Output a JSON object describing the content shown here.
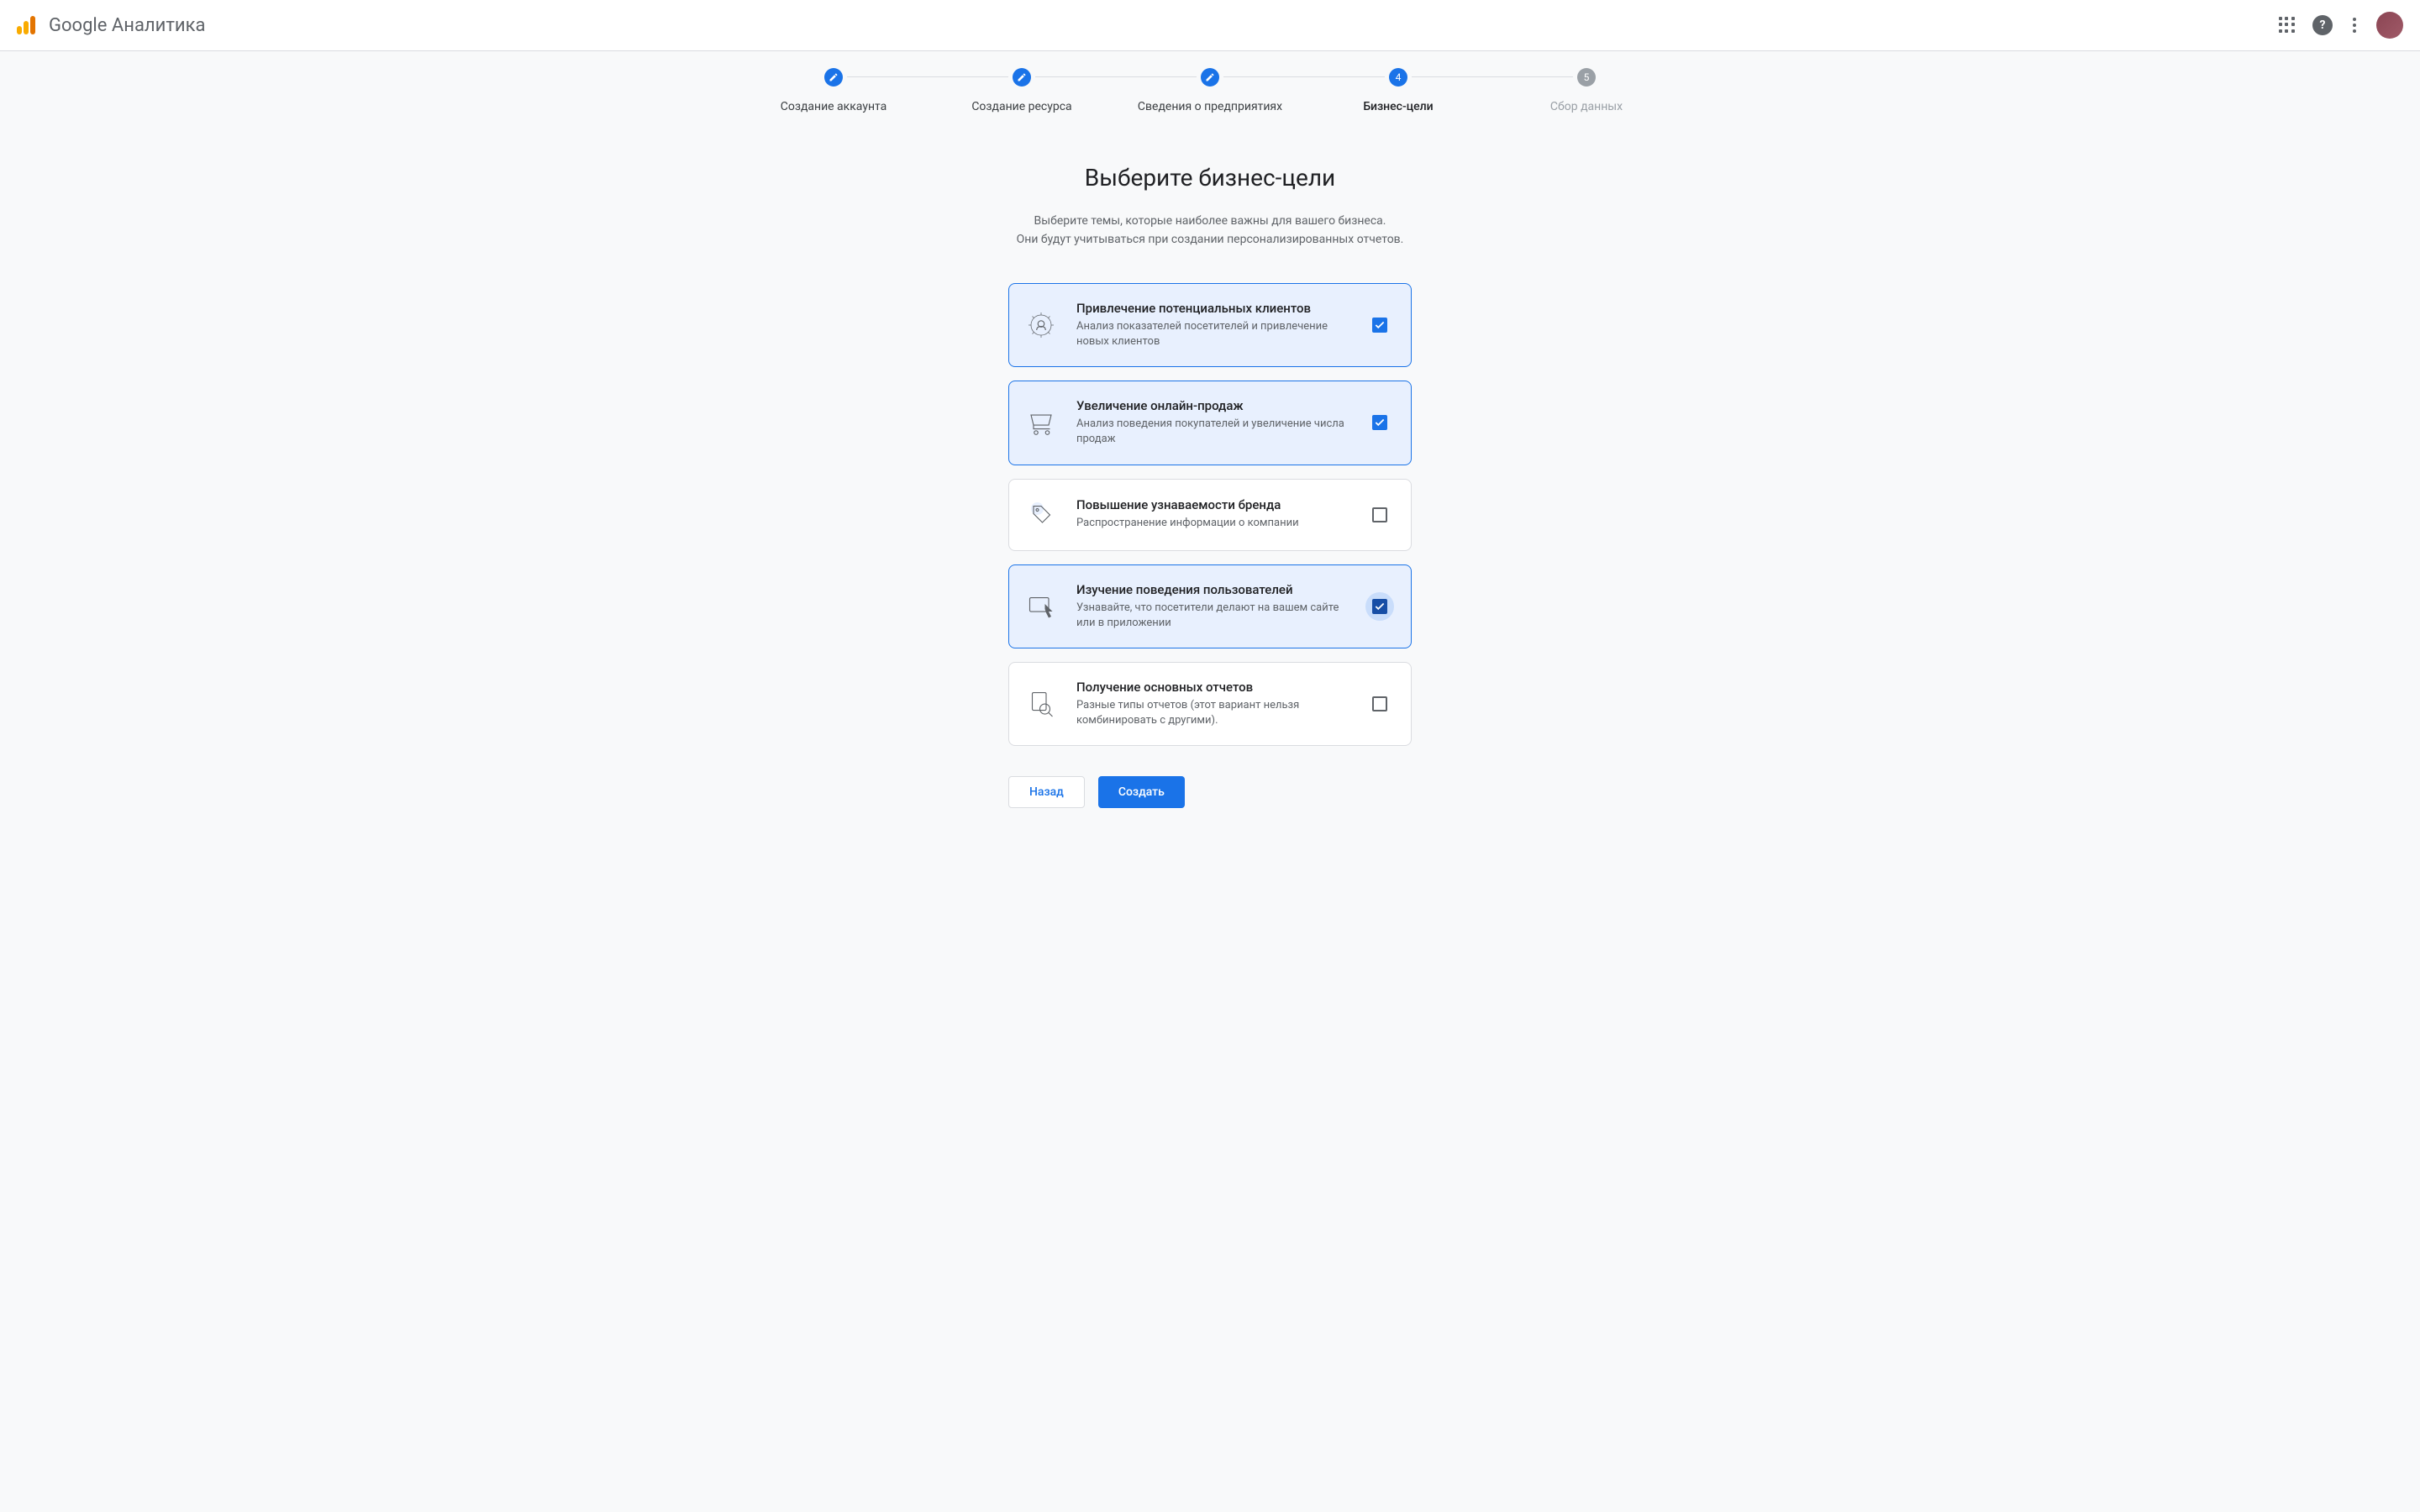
{
  "header": {
    "product_name": "Google Аналитика"
  },
  "stepper": {
    "steps": [
      {
        "label": "Создание аккаунта",
        "state": "completed"
      },
      {
        "label": "Создание ресурса",
        "state": "completed"
      },
      {
        "label": "Сведения о предприятиях",
        "state": "completed"
      },
      {
        "label": "Бизнес-цели",
        "state": "current",
        "number": "4"
      },
      {
        "label": "Сбор данных",
        "state": "pending",
        "number": "5"
      }
    ]
  },
  "content": {
    "title": "Выберите бизнес-цели",
    "subtitle_line1": "Выберите темы, которые наиболее важны для вашего бизнеса.",
    "subtitle_line2": "Они будут учитываться при создании персонализированных отчетов."
  },
  "cards": [
    {
      "title": "Привлечение потенциальных клиентов",
      "desc": "Анализ показателей посетителей и привлечение новых клиентов",
      "checked": true,
      "icon": "leads"
    },
    {
      "title": "Увеличение онлайн-продаж",
      "desc": "Анализ поведения покупателей и увеличение числа продаж",
      "checked": true,
      "icon": "cart"
    },
    {
      "title": "Повышение узнаваемости бренда",
      "desc": "Распространение информации о компании",
      "checked": false,
      "icon": "tag"
    },
    {
      "title": "Изучение поведения пользователей",
      "desc": "Узнавайте, что посетители делают на вашем сайте или в приложении",
      "checked": true,
      "icon": "behavior",
      "halo": true
    },
    {
      "title": "Получение основных отчетов",
      "desc": "Разные типы отчетов (этот вариант нельзя комбинировать с другими).",
      "checked": false,
      "icon": "reports"
    }
  ],
  "buttons": {
    "back": "Назад",
    "create": "Создать"
  }
}
